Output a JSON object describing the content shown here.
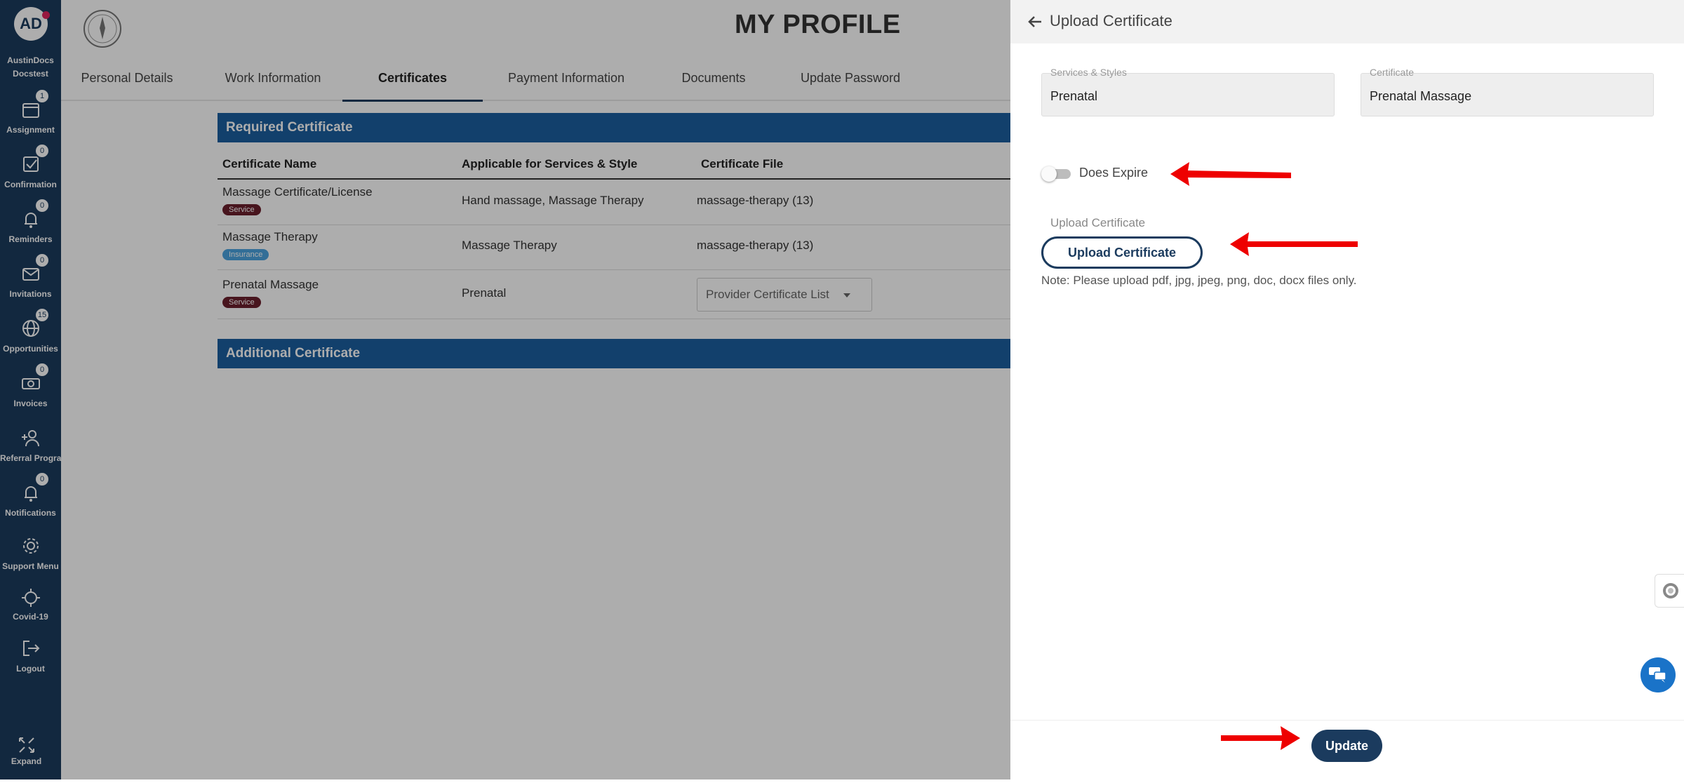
{
  "sidebar": {
    "avatar_initials": "AD",
    "user_name_line1": "AustinDocs",
    "user_name_line2": "Docstest",
    "items": [
      {
        "label": "Assignment",
        "badge": "1",
        "icon": "calendar-icon"
      },
      {
        "label": "Confirmation",
        "badge": "0",
        "icon": "checkbox-icon"
      },
      {
        "label": "Reminders",
        "badge": "0",
        "icon": "bell-icon"
      },
      {
        "label": "Invitations",
        "badge": "0",
        "icon": "envelope-icon"
      },
      {
        "label": "Opportunities",
        "badge": "15",
        "icon": "globe-icon"
      },
      {
        "label": "Invoices",
        "badge": "0",
        "icon": "money-icon"
      },
      {
        "label": "Referral Program",
        "badge": "",
        "icon": "add-user-icon"
      },
      {
        "label": "Notifications",
        "badge": "0",
        "icon": "bell-icon"
      },
      {
        "label": "Support Menu",
        "badge": "",
        "icon": "gear-icon"
      },
      {
        "label": "Covid-19",
        "badge": "",
        "icon": "virus-icon"
      },
      {
        "label": "Logout",
        "badge": "",
        "icon": "logout-icon"
      }
    ],
    "expand_label": "Expand"
  },
  "header": {
    "title": "MY PROFILE"
  },
  "tabs": [
    {
      "label": "Personal Details"
    },
    {
      "label": "Work Information"
    },
    {
      "label": "Certificates"
    },
    {
      "label": "Payment Information"
    },
    {
      "label": "Documents"
    },
    {
      "label": "Update Password"
    }
  ],
  "required": {
    "title": "Required Certificate",
    "columns": [
      "Certificate Name",
      "Applicable for Services & Style",
      "Certificate File"
    ],
    "rows": [
      {
        "name": "Massage Certificate/License",
        "tag": "Service",
        "applicable": "Hand massage, Massage Therapy",
        "file": "massage-therapy (13)"
      },
      {
        "name": "Massage Therapy",
        "tag": "Insurance",
        "applicable": "Massage Therapy",
        "file": "massage-therapy (13)"
      },
      {
        "name": "Prenatal Massage",
        "tag": "Service",
        "applicable": "Prenatal",
        "file": "Provider Certificate List"
      }
    ]
  },
  "additional": {
    "title": "Additional Certificate"
  },
  "panel": {
    "title": "Upload Certificate",
    "services_label": "Services & Styles",
    "services_value": "Prenatal",
    "certificate_label": "Certificate",
    "certificate_value": "Prenatal Massage",
    "toggle_label": "Does Expire",
    "upload_label": "Upload Certificate",
    "upload_button": "Upload Certificate",
    "note": "Note: Please upload pdf, jpg, jpeg, png, doc, docx files only.",
    "update_button": "Update"
  },
  "colors": {
    "sidebar": "#1b3b5e",
    "section_bar": "#1b5f9f",
    "arrow": "#ee0000"
  }
}
